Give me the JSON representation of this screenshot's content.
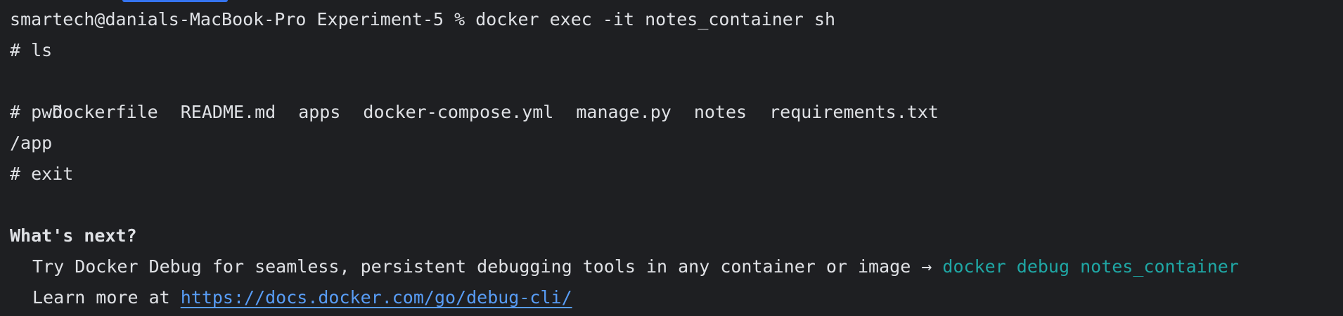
{
  "terminal": {
    "prompt_line": "smartech@danials-MacBook-Pro Experiment-5 % docker exec -it notes_container sh",
    "cmd_ls": "# ls",
    "ls_output": [
      "Dockerfile",
      "README.md",
      "apps",
      "docker-compose.yml",
      "manage.py",
      "notes",
      "requirements.txt"
    ],
    "cmd_pwd": "# pwd",
    "pwd_output": "/app",
    "cmd_exit": "# exit",
    "whats_next_heading": "What's next?",
    "debug_hint_text": "Try Docker Debug for seamless, persistent debugging tools in any container or image → ",
    "debug_hint_command": "docker debug notes_container",
    "learn_more_text": "Learn more at ",
    "learn_more_link": "https://docs.docker.com/go/debug-cli/"
  },
  "colors": {
    "background": "#1e1f22",
    "foreground": "#dfe1e5",
    "accent_command": "#1fa7a5",
    "link": "#589df6",
    "tab_indicator": "#3574f0"
  }
}
